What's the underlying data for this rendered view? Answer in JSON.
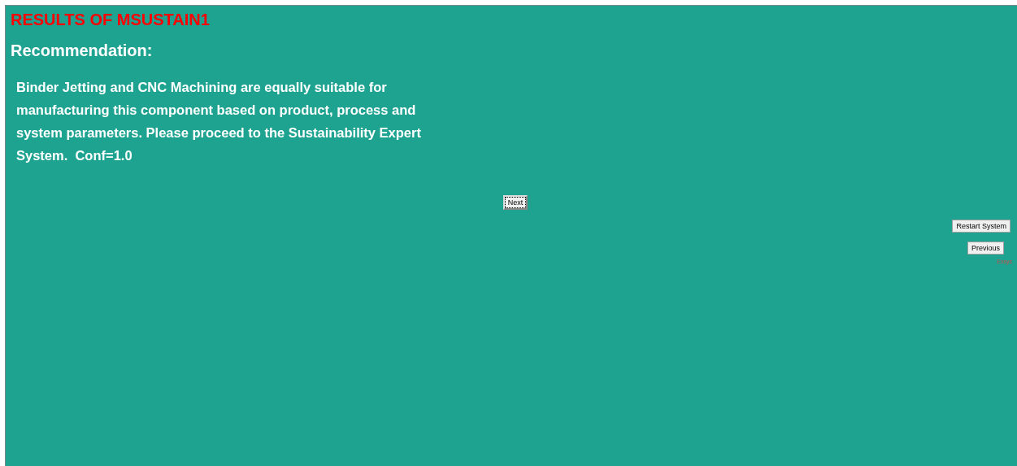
{
  "title": "RESULTS OF MSUSTAIN1",
  "heading": "Recommendation:",
  "message": "Binder Jetting and CNC Machining are equally suitable for manufacturing this component based on product, process and system parameters. Please proceed to the Sustainability Expert System.  Conf=1.0",
  "next_button": {
    "label": "Next",
    "focused": true
  },
  "side_buttons": [
    {
      "label": "Restart System"
    },
    {
      "label": "Previous"
    }
  ],
  "footer_label": "Exsys"
}
